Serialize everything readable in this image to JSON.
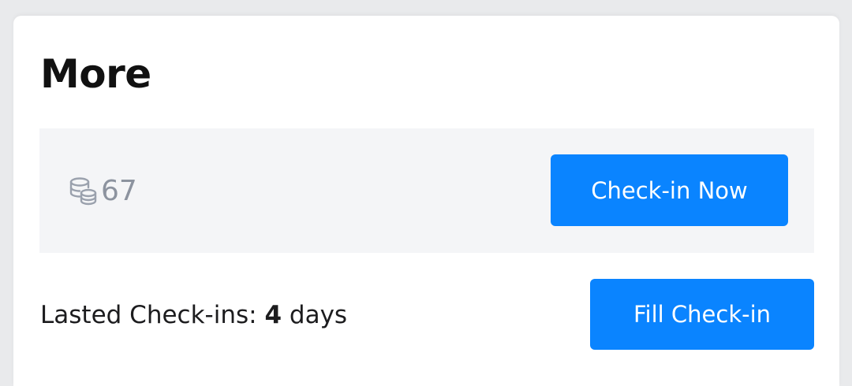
{
  "section": {
    "title": "More"
  },
  "points": {
    "icon": "coins-stack-icon",
    "value": "67"
  },
  "checkin": {
    "button_label": "Check-in Now"
  },
  "streak": {
    "label": "Lasted Check-ins:",
    "count": "4",
    "unit": "days"
  },
  "fill": {
    "button_label": "Fill Check-in"
  },
  "colors": {
    "accent": "#0a84ff",
    "panel": "#f4f5f7",
    "muted_text": "#8c939f"
  }
}
